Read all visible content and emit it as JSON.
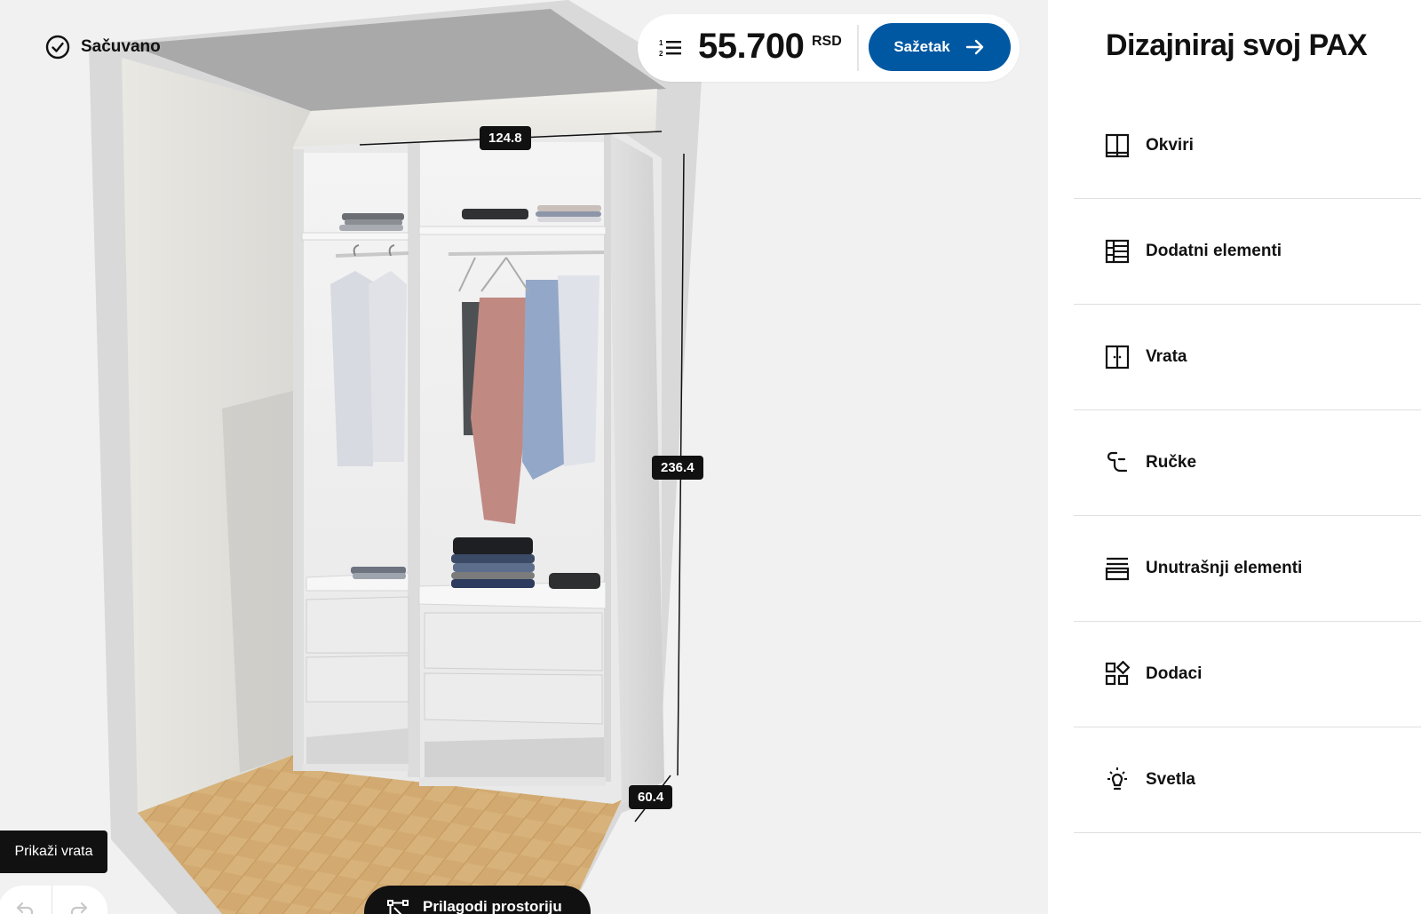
{
  "status": {
    "saved_label": "Sačuvano"
  },
  "price": {
    "amount": "55.700",
    "currency": "RSD",
    "summary_label": "Sažetak"
  },
  "dimensions": {
    "width": "124.8",
    "height": "236.4",
    "depth": "60.4"
  },
  "viewport": {
    "show_doors_label": "Prikaži vrata",
    "adjust_room_label": "Prilagodi prostoriju"
  },
  "panel": {
    "title": "Dizajniraj svoj PAX",
    "menu": [
      {
        "label": "Okviri",
        "icon": "frames-icon"
      },
      {
        "label": "Dodatni elementi",
        "icon": "additional-elements-icon"
      },
      {
        "label": "Vrata",
        "icon": "doors-icon"
      },
      {
        "label": "Ručke",
        "icon": "handles-icon"
      },
      {
        "label": "Unutrašnji elementi",
        "icon": "interior-elements-icon"
      },
      {
        "label": "Dodaci",
        "icon": "accessories-icon"
      },
      {
        "label": "Svetla",
        "icon": "lights-icon"
      }
    ]
  },
  "colors": {
    "accent": "#0058a3",
    "panel_bg": "#ffffff",
    "viewport_bg": "#f1f1f1",
    "label_bg": "#111111"
  }
}
